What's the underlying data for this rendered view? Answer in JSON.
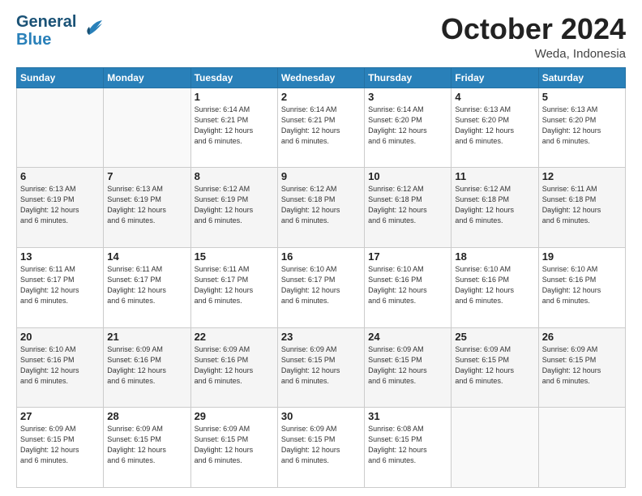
{
  "logo": {
    "line1": "General",
    "line2": "Blue"
  },
  "title": "October 2024",
  "location": "Weda, Indonesia",
  "days_header": [
    "Sunday",
    "Monday",
    "Tuesday",
    "Wednesday",
    "Thursday",
    "Friday",
    "Saturday"
  ],
  "weeks": [
    [
      {
        "day": "",
        "info": ""
      },
      {
        "day": "",
        "info": ""
      },
      {
        "day": "1",
        "info": "Sunrise: 6:14 AM\nSunset: 6:21 PM\nDaylight: 12 hours\nand 6 minutes."
      },
      {
        "day": "2",
        "info": "Sunrise: 6:14 AM\nSunset: 6:21 PM\nDaylight: 12 hours\nand 6 minutes."
      },
      {
        "day": "3",
        "info": "Sunrise: 6:14 AM\nSunset: 6:20 PM\nDaylight: 12 hours\nand 6 minutes."
      },
      {
        "day": "4",
        "info": "Sunrise: 6:13 AM\nSunset: 6:20 PM\nDaylight: 12 hours\nand 6 minutes."
      },
      {
        "day": "5",
        "info": "Sunrise: 6:13 AM\nSunset: 6:20 PM\nDaylight: 12 hours\nand 6 minutes."
      }
    ],
    [
      {
        "day": "6",
        "info": "Sunrise: 6:13 AM\nSunset: 6:19 PM\nDaylight: 12 hours\nand 6 minutes."
      },
      {
        "day": "7",
        "info": "Sunrise: 6:13 AM\nSunset: 6:19 PM\nDaylight: 12 hours\nand 6 minutes."
      },
      {
        "day": "8",
        "info": "Sunrise: 6:12 AM\nSunset: 6:19 PM\nDaylight: 12 hours\nand 6 minutes."
      },
      {
        "day": "9",
        "info": "Sunrise: 6:12 AM\nSunset: 6:18 PM\nDaylight: 12 hours\nand 6 minutes."
      },
      {
        "day": "10",
        "info": "Sunrise: 6:12 AM\nSunset: 6:18 PM\nDaylight: 12 hours\nand 6 minutes."
      },
      {
        "day": "11",
        "info": "Sunrise: 6:12 AM\nSunset: 6:18 PM\nDaylight: 12 hours\nand 6 minutes."
      },
      {
        "day": "12",
        "info": "Sunrise: 6:11 AM\nSunset: 6:18 PM\nDaylight: 12 hours\nand 6 minutes."
      }
    ],
    [
      {
        "day": "13",
        "info": "Sunrise: 6:11 AM\nSunset: 6:17 PM\nDaylight: 12 hours\nand 6 minutes."
      },
      {
        "day": "14",
        "info": "Sunrise: 6:11 AM\nSunset: 6:17 PM\nDaylight: 12 hours\nand 6 minutes."
      },
      {
        "day": "15",
        "info": "Sunrise: 6:11 AM\nSunset: 6:17 PM\nDaylight: 12 hours\nand 6 minutes."
      },
      {
        "day": "16",
        "info": "Sunrise: 6:10 AM\nSunset: 6:17 PM\nDaylight: 12 hours\nand 6 minutes."
      },
      {
        "day": "17",
        "info": "Sunrise: 6:10 AM\nSunset: 6:16 PM\nDaylight: 12 hours\nand 6 minutes."
      },
      {
        "day": "18",
        "info": "Sunrise: 6:10 AM\nSunset: 6:16 PM\nDaylight: 12 hours\nand 6 minutes."
      },
      {
        "day": "19",
        "info": "Sunrise: 6:10 AM\nSunset: 6:16 PM\nDaylight: 12 hours\nand 6 minutes."
      }
    ],
    [
      {
        "day": "20",
        "info": "Sunrise: 6:10 AM\nSunset: 6:16 PM\nDaylight: 12 hours\nand 6 minutes."
      },
      {
        "day": "21",
        "info": "Sunrise: 6:09 AM\nSunset: 6:16 PM\nDaylight: 12 hours\nand 6 minutes."
      },
      {
        "day": "22",
        "info": "Sunrise: 6:09 AM\nSunset: 6:16 PM\nDaylight: 12 hours\nand 6 minutes."
      },
      {
        "day": "23",
        "info": "Sunrise: 6:09 AM\nSunset: 6:15 PM\nDaylight: 12 hours\nand 6 minutes."
      },
      {
        "day": "24",
        "info": "Sunrise: 6:09 AM\nSunset: 6:15 PM\nDaylight: 12 hours\nand 6 minutes."
      },
      {
        "day": "25",
        "info": "Sunrise: 6:09 AM\nSunset: 6:15 PM\nDaylight: 12 hours\nand 6 minutes."
      },
      {
        "day": "26",
        "info": "Sunrise: 6:09 AM\nSunset: 6:15 PM\nDaylight: 12 hours\nand 6 minutes."
      }
    ],
    [
      {
        "day": "27",
        "info": "Sunrise: 6:09 AM\nSunset: 6:15 PM\nDaylight: 12 hours\nand 6 minutes."
      },
      {
        "day": "28",
        "info": "Sunrise: 6:09 AM\nSunset: 6:15 PM\nDaylight: 12 hours\nand 6 minutes."
      },
      {
        "day": "29",
        "info": "Sunrise: 6:09 AM\nSunset: 6:15 PM\nDaylight: 12 hours\nand 6 minutes."
      },
      {
        "day": "30",
        "info": "Sunrise: 6:09 AM\nSunset: 6:15 PM\nDaylight: 12 hours\nand 6 minutes."
      },
      {
        "day": "31",
        "info": "Sunrise: 6:08 AM\nSunset: 6:15 PM\nDaylight: 12 hours\nand 6 minutes."
      },
      {
        "day": "",
        "info": ""
      },
      {
        "day": "",
        "info": ""
      }
    ]
  ]
}
